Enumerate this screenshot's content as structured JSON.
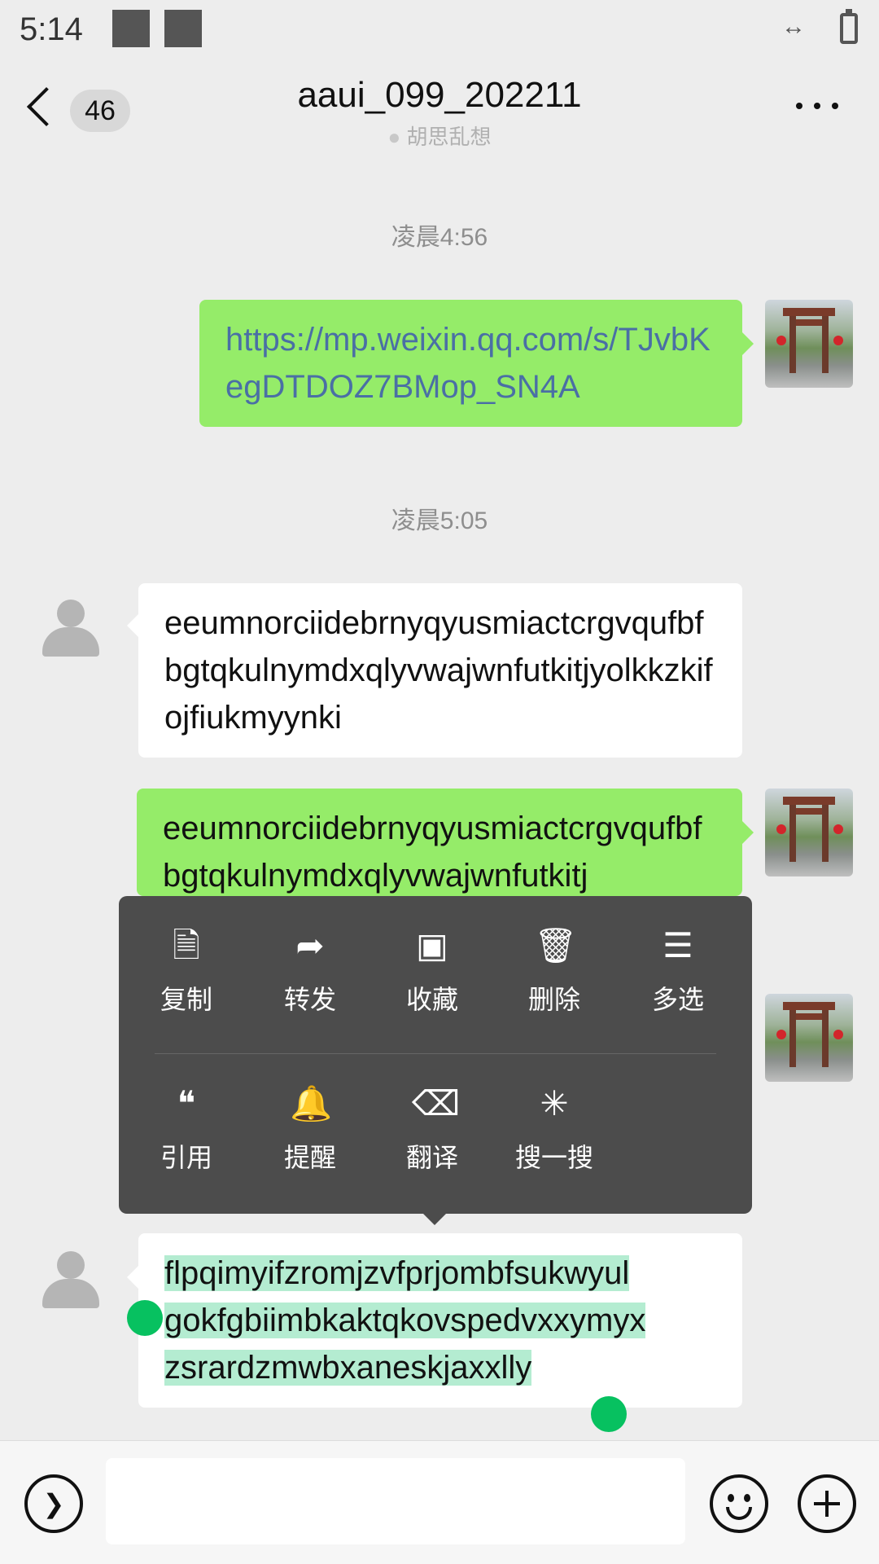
{
  "status_bar": {
    "time": "5:14",
    "data_icon": "data-transfer-icon",
    "battery_icon": "battery-icon"
  },
  "header": {
    "back_icon": "back-arrow-icon",
    "unread_count": "46",
    "title": "aaui_099_202211",
    "subtitle": "胡思乱想",
    "more_icon": "more-dots-icon"
  },
  "messages": [
    {
      "time": "凌晨4:56"
    },
    {
      "sender": "me",
      "text": "https://mp.weixin.qq.com/s/TJvbKegDTDOZ7BMop_SN4A",
      "type": "link"
    },
    {
      "time": "凌晨5:05"
    },
    {
      "sender": "them",
      "text": "eeumnorciidebrnyqyusmiactcrgvqufbfbgtqkulnymdxqlyvwajwnfutkitjyolkkzkifojfiukmyynki"
    },
    {
      "sender": "me",
      "text": "eeumnorciidebrnyqyusmiactcrgvqufbfbgtqkulnymdxqlyvwajwnfutkitj"
    },
    {
      "sender": "them",
      "line1": "flpqimyifzromjzvfprjombfsukwyul",
      "line2": "gokfgbiimbkaktqkovspedvxxymyx",
      "line3": "zsrardzmwbxaneskjaxxlly",
      "selected": true
    }
  ],
  "context_menu": {
    "items": [
      {
        "label": "复制",
        "icon": "copy-icon"
      },
      {
        "label": "转发",
        "icon": "forward-icon"
      },
      {
        "label": "收藏",
        "icon": "favorite-icon"
      },
      {
        "label": "删除",
        "icon": "delete-icon"
      },
      {
        "label": "多选",
        "icon": "multi-select-icon"
      },
      {
        "label": "引用",
        "icon": "quote-icon"
      },
      {
        "label": "提醒",
        "icon": "remind-icon"
      },
      {
        "label": "翻译",
        "icon": "translate-icon"
      },
      {
        "label": "搜一搜",
        "icon": "search-icon"
      }
    ]
  },
  "input_bar": {
    "placeholder": "",
    "voice_icon": "voice-icon",
    "emoji_icon": "emoji-icon",
    "plus_icon": "plus-icon"
  },
  "colors": {
    "me_bubble": "#95ec69",
    "them_bubble": "#ffffff",
    "menu_bg": "#4c4c4c",
    "selection": "#b4ecd1",
    "handle": "#07c160",
    "link": "#4a6fa5"
  }
}
